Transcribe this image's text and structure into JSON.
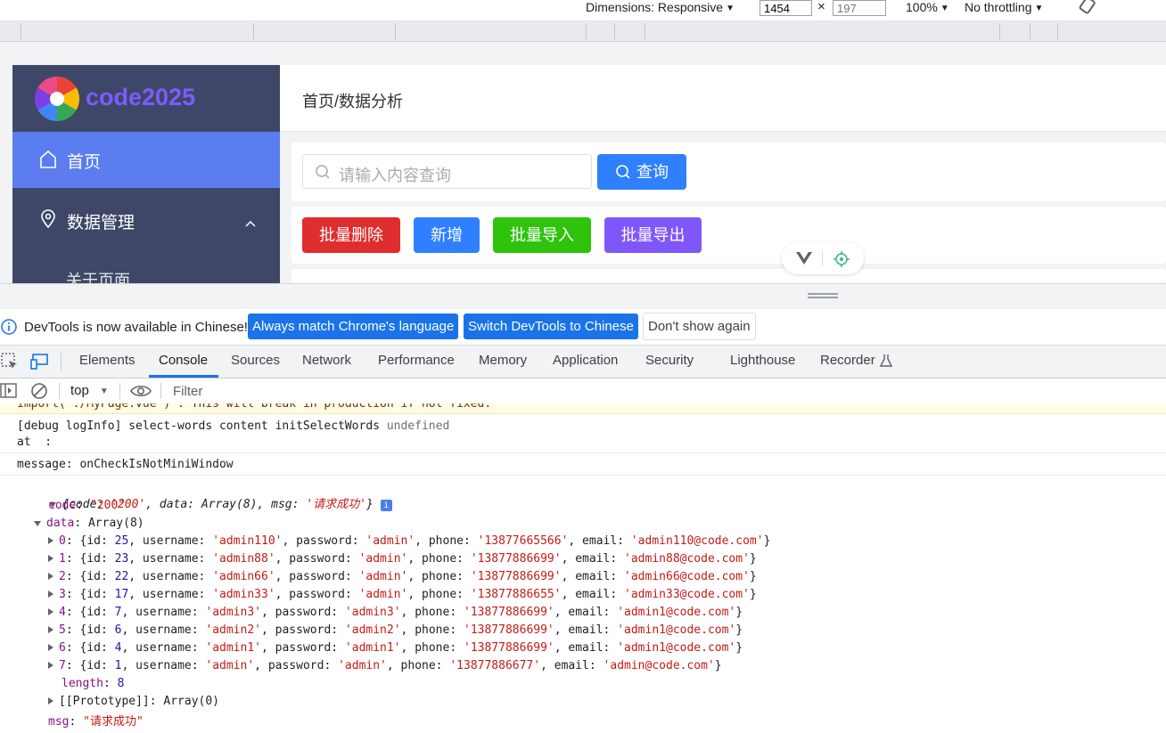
{
  "topbar": {
    "dimensions_label": "Dimensions: Responsive",
    "width_value": "1454",
    "height_value": "197",
    "zoom": "100%",
    "throttling": "No throttling"
  },
  "app": {
    "logo_text": "code2025",
    "menu": {
      "home": "首页",
      "data_mgmt": "数据管理",
      "about": "关于页面"
    },
    "breadcrumb": "首页/数据分析",
    "search": {
      "placeholder": "请输入内容查询",
      "button": "查询"
    },
    "actions": {
      "batch_delete": "批量删除",
      "add": "新增",
      "batch_import": "批量导入",
      "batch_export": "批量导出"
    },
    "colors": {
      "sidebar": "#3e4767",
      "menu_active": "#5b7df0",
      "primary": "#2e80ff",
      "danger": "#e02d2d",
      "success": "#2fc30c",
      "purple": "#7f57f9"
    }
  },
  "infobar": {
    "message": "DevTools is now available in Chinese!",
    "btn_match": "Always match Chrome's language",
    "btn_switch": "Switch DevTools to Chinese",
    "btn_dismiss": "Don't show again"
  },
  "tabs": [
    "Elements",
    "Console",
    "Sources",
    "Network",
    "Performance",
    "Memory",
    "Application",
    "Security",
    "Lighthouse",
    "Recorder"
  ],
  "active_tab": "Console",
  "console_toolbar": {
    "context": "top",
    "filter_placeholder": "Filter"
  },
  "console": {
    "warning_line": "import('./MyPage.vue')`: This will break in production if not fixed.",
    "debug_line": "[debug logInfo] select-words content initSelectWords",
    "debug_value": "undefined",
    "at_line": "at  :",
    "message_line": "message: onCheckIsNotMiniWindow",
    "response": {
      "code": "200",
      "msg": "请求成功",
      "data_count": 8,
      "length": 8,
      "proto_label": "[[Prototype]]: Array(0)",
      "rows": [
        {
          "index": "0",
          "id": 25,
          "username": "admin110",
          "password": "admin",
          "phone": "13877665566",
          "email": "admin110@code.com"
        },
        {
          "index": "1",
          "id": 23,
          "username": "admin88",
          "password": "admin",
          "phone": "13877886699",
          "email": "admin88@code.com"
        },
        {
          "index": "2",
          "id": 22,
          "username": "admin66",
          "password": "admin",
          "phone": "13877886699",
          "email": "admin66@code.com"
        },
        {
          "index": "3",
          "id": 17,
          "username": "admin33",
          "password": "admin",
          "phone": "13877886655",
          "email": "admin33@code.com"
        },
        {
          "index": "4",
          "id": 7,
          "username": "admin3",
          "password": "admin3",
          "phone": "13877886699",
          "email": "admin1@code.com"
        },
        {
          "index": "5",
          "id": 6,
          "username": "admin2",
          "password": "admin2",
          "phone": "13877886699",
          "email": "admin1@code.com"
        },
        {
          "index": "6",
          "id": 4,
          "username": "admin1",
          "password": "admin1",
          "phone": "13877886699",
          "email": "admin1@code.com"
        },
        {
          "index": "7",
          "id": 1,
          "username": "admin",
          "password": "admin",
          "phone": "13877886677",
          "email": "admin@code.com"
        }
      ]
    }
  }
}
